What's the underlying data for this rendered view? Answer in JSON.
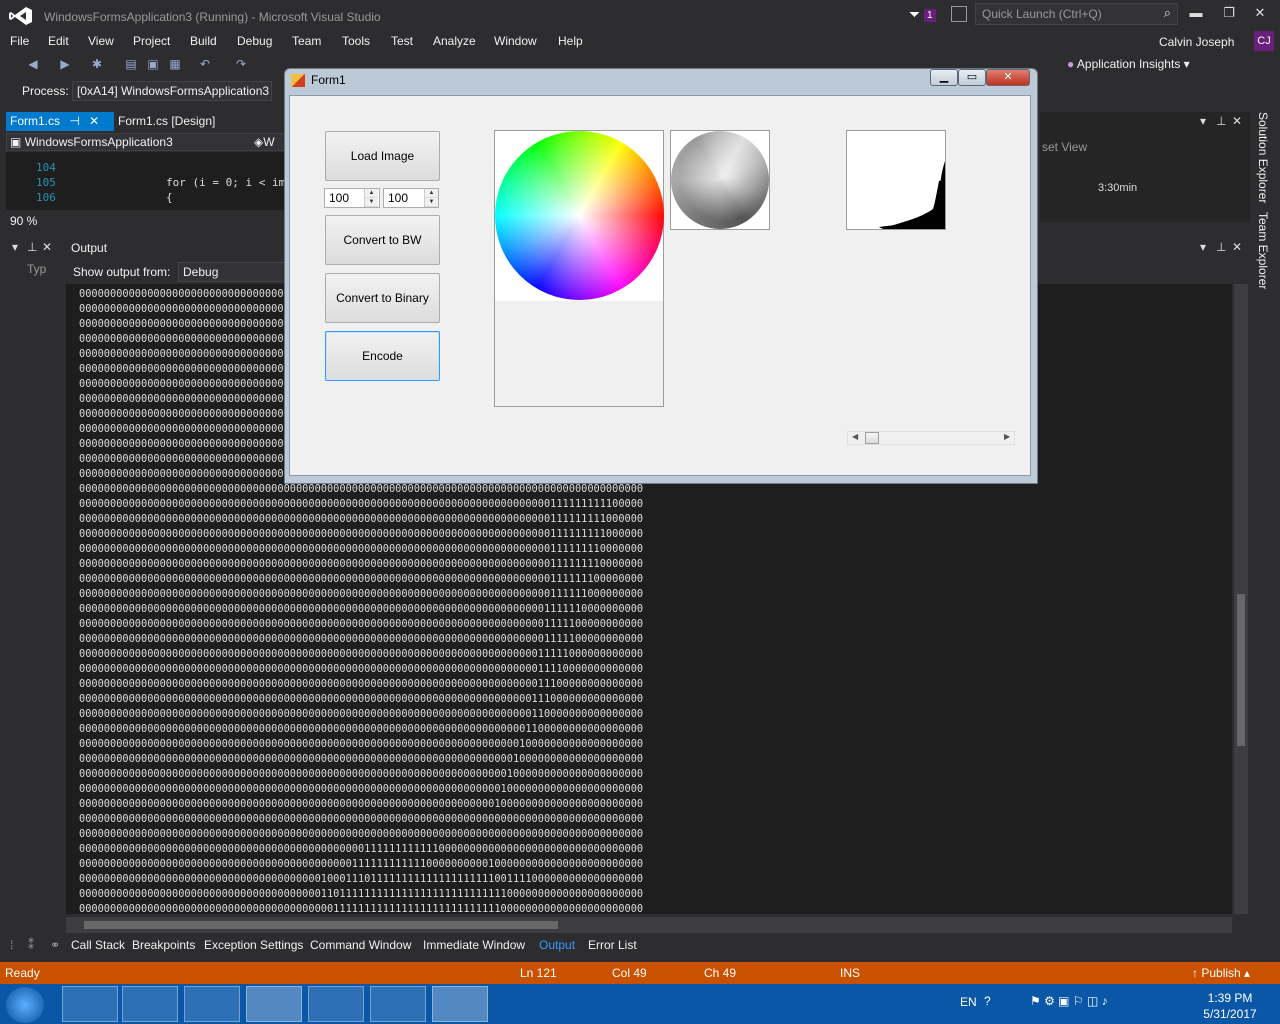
{
  "window": {
    "title": "WindowsFormsApplication3 (Running) - Microsoft Visual Studio",
    "filter_badge": "1",
    "quick_launch_placeholder": "Quick Launch (Ctrl+Q)",
    "user": "Calvin Joseph",
    "avatar": "CJ",
    "min": "▬",
    "max": "❐",
    "close": "✕"
  },
  "menu": [
    "File",
    "Edit",
    "View",
    "Project",
    "Build",
    "Debug",
    "Team",
    "Tools",
    "Test",
    "Analyze",
    "Window",
    "Help"
  ],
  "toolbar": {
    "app_insights": "Application Insights",
    "process_label": "Process:",
    "process_value": "[0xA14] WindowsFormsApplication3"
  },
  "doc_tabs": {
    "active": "Form1.cs",
    "second": "Form1.cs [Design]",
    "nav_class": "WindowsFormsApplication3",
    "nav_member": "W"
  },
  "editor": {
    "lines": [
      {
        "num": "104",
        "code": ""
      },
      {
        "num": "105",
        "code": "for (i = 0; i < im"
      },
      {
        "num": "106",
        "code": "{"
      }
    ],
    "zoom": "90 %"
  },
  "output": {
    "title": "Output",
    "show_from_label": "Show output from:",
    "show_from_value": "Debug",
    "left_label": "Typ",
    "lines": [
      "0000000000000000000000000000000000000000000000000000000000000000000000000000000000000000000",
      "0000000000000000000000000000000000000000000000000000000000000000000000000000000000000000000",
      "0000000000000000000000000000000000000000000000000000000000000000000000000000000000000000000",
      "0000000000000000000000000000000000000000000000000000000000000000000000000000000000000000000",
      "0000000000000000000000000000000000000000000000000000000000000000000000000000000000000000000",
      "0000000000000000000000000000000000000000000000000000000000000000000000000000000000000000000",
      "0000000000000000000000000000000000000000000000000000000000000000000000000000000000000000000",
      "0000000000000000000000000000000000000000000000000000000000000000000000000000000000000000000",
      "0000000000000000000000000000000000000000000000000000000000000000000000000000000000000000000",
      "0000000000000000000000000000000000000000000000000000000000000000000000000000000000000000000",
      "0000000000000000000000000000000000000000000000000000000000000000000000000000000000000000000",
      "0000000000000000000000000000000000000000000000000000000000000000000000000000000000000000000",
      "0000000000000000000000000000000000000000000000000000000000000000000000000000000000000000000",
      "0000000000000000000000000000000000000000000000000000000000000000000000000000000000000000000",
      "0000000000000000000000000000000000000000000000000000000000000000000000000000111111111100000",
      "0000000000000000000000000000000000000000000000000000000000000000000000000000111111111000000",
      "0000000000000000000000000000000000000000000000000000000000000000000000000000111111111000000",
      "0000000000000000000000000000000000000000000000000000000000000000000000000000111111110000000",
      "0000000000000000000000000000000000000000000000000000000000000000000000000000111111110000000",
      "0000000000000000000000000000000000000000000000000000000000000000000000000000111111100000000",
      "0000000000000000000000000000000000000000000000000000000000000000000000000000111111000000000",
      "0000000000000000000000000000000000000000000000000000000000000000000000000001111110000000000",
      "0000000000000000000000000000000000000000000000000000000000000000000000000001111100000000000",
      "0000000000000000000000000000000000000000000000000000000000000000000000000001111100000000000",
      "0000000000000000000000000000000000000000000000000000000000000000000000000011111000000000000",
      "0000000000000000000000000000000000000000000000000000000000000000000000000011110000000000000",
      "0000000000000000000000000000000000000000000000000000000000000000000000000011100000000000000",
      "0000000000000000000000000000000000000000000000000000000000000000000000000111000000000000000",
      "0000000000000000000000000000000000000000000000000000000000000000000000000110000000000000000",
      "0000000000000000000000000000000000000000000000000000000000000000000000001100000000000000000",
      "0000000000000000000000000000000000000000000000000000000000000000000000010000000000000000000",
      "0000000000000000000000000000000000000000000000000000000000000000000000100000000000000000000",
      "0000000000000000000000000000000000000000000000000000000000000000000001000000000000000000000",
      "0000000000000000000000000000000000000000000000000000000000000000000010000000000000000000000",
      "0000000000000000000000000000000000000000000000000000000000000000000100000000000000000000000",
      "0000000000000000000000000000000000000000000000000000000000000000000000000000000000000000000",
      "0000000000000000000000000000000000000000000000000000000000000000000000000000000000000000000",
      "0000000000000000000000000000000000000000000000111111111111000000000000000000000000000000000",
      "0000000000000000000000000000000000000000000011111111111100000000001000000000000000000000000",
      "0000000000000000000000000000000000000001000111011111111111111111111001111000000000000000000",
      "0000000000000000000000000000000000000001101111111111111111111111111110000000000000000000000",
      "0000000000000000000000000000000000000000011111111111111111111111111100000000000000000000000",
      "0000000000000000000000000000000000000000000011111111111111111110000000000000000000000000000"
    ]
  },
  "bottom_tabs": [
    "Call Stack",
    "Breakpoints",
    "Exception Settings",
    "Command Window",
    "Immediate Window",
    "Output",
    "Error List"
  ],
  "status": {
    "state": "Ready",
    "ln": "Ln 121",
    "col": "Col 49",
    "ch": "Ch 49",
    "ins": "INS",
    "publish": "Publish",
    "color": "#ca5100"
  },
  "right_dock": {
    "solution_explorer": "Solution Explorer",
    "team_explorer": "Team Explorer",
    "panel_text_1": "set View",
    "panel_text_2": "3:30min"
  },
  "form": {
    "title": "Form1",
    "load_image": "Load Image",
    "width_value": "100",
    "height_value": "100",
    "convert_bw": "Convert to BW",
    "convert_binary": "Convert to Binary",
    "encode": "Encode"
  },
  "taskbar": {
    "lang": "EN",
    "time": "1:39 PM",
    "date": "5/31/2017"
  }
}
